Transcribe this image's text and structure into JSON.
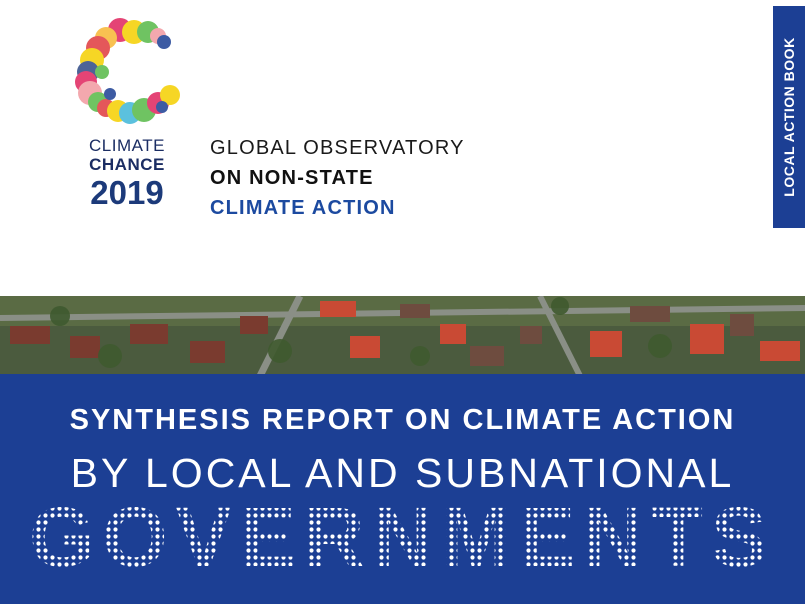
{
  "brand": {
    "line1": "CLIMATE",
    "line2": "CHANCE",
    "year": "2019"
  },
  "observatory": {
    "line1": "GLOBAL OBSERVATORY",
    "line2": "ON NON-STATE",
    "line3": "CLIMATE ACTION"
  },
  "side_tab": {
    "label": "LOCAL ACTION BOOK"
  },
  "title": {
    "line1": "SYNTHESIS REPORT ON CLIMATE ACTION",
    "line2": "BY LOCAL AND SUBNATIONAL",
    "line3": "GOVERNMENTS"
  },
  "colors": {
    "brand_blue": "#1c3f94",
    "dark_navy": "#1b2d63",
    "accent_blue": "#1c4aa0"
  },
  "icons": {
    "logo": "climate-chance-c-logo",
    "cover_photo": "aerial-town-photo"
  }
}
